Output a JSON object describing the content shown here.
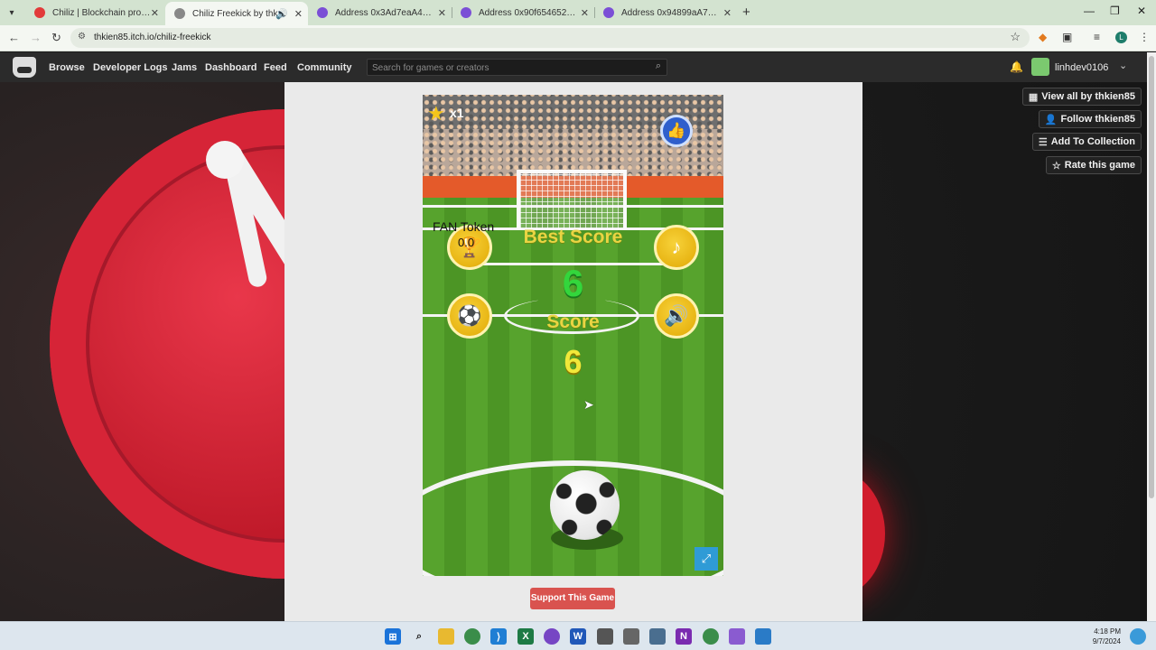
{
  "browser": {
    "tabs": [
      {
        "title": "Chiliz | Blockchain provider for",
        "fav_color": "#e23a3a"
      },
      {
        "title": "Chiliz Freekick by thkien85",
        "fav_color": "#888888",
        "active": true
      },
      {
        "title": "Address 0x3Ad7eaA48A334d0",
        "fav_color": "#7b4fd6"
      },
      {
        "title": "Address 0x90f654652002Cc979",
        "fav_color": "#7b4fd6"
      },
      {
        "title": "Address 0x94899aA7Ab54CC5",
        "fav_color": "#7b4fd6"
      }
    ],
    "url": "thkien85.itch.io/chiliz-freekick"
  },
  "itch_header": {
    "nav": [
      "Browse",
      "Developer Logs",
      "Jams",
      "Dashboard",
      "Feed",
      "Community"
    ],
    "search_placeholder": "Search for games or creators",
    "username": "linhdev0106"
  },
  "actions": [
    {
      "label": "View all by thkien85",
      "icon": "game-icon"
    },
    {
      "label": "Follow thkien85",
      "icon": "follow-icon"
    },
    {
      "label": "Add To Collection",
      "icon": "collection-icon"
    },
    {
      "label": "Rate this game",
      "icon": "star-icon"
    }
  ],
  "game": {
    "multiplier": "x1",
    "fan_token_label": "FAN Token",
    "fan_token_value": "0.0",
    "best_score_label": "Best Score",
    "best_score_value": "6",
    "score_label": "Score",
    "score_value": "6"
  },
  "support_label": "Support This Game",
  "clock": {
    "time": "4:18 PM",
    "date": "9/7/2024"
  },
  "colors": {
    "accent": "#d9534f",
    "itch_bar": "#2b2b2b",
    "pitch": "#57a32d"
  }
}
